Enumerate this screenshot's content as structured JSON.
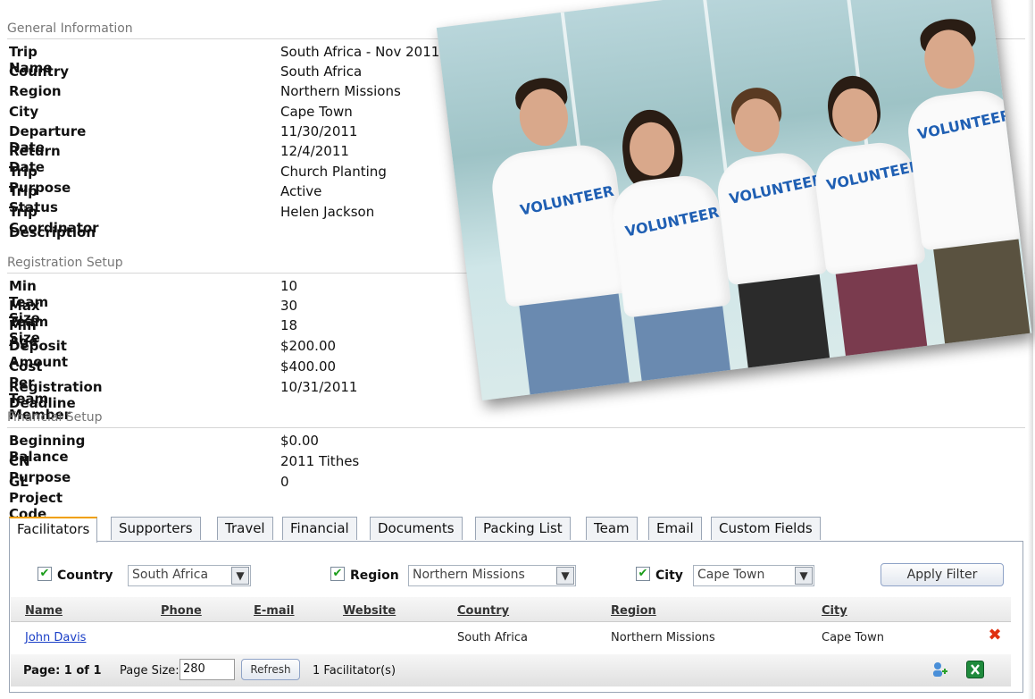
{
  "sections": {
    "general": "General Information",
    "registration": "Registration Setup",
    "financial": "Financial Setup"
  },
  "general_fields": [
    {
      "label": "Trip Name",
      "value": "South Africa - Nov 2011"
    },
    {
      "label": "Country",
      "value": "South Africa"
    },
    {
      "label": "Region",
      "value": "Northern Missions"
    },
    {
      "label": "City",
      "value": "Cape Town"
    },
    {
      "label": "Departure Date",
      "value": "11/30/2011"
    },
    {
      "label": "Return Date",
      "value": "12/4/2011"
    },
    {
      "label": "Trip Purpose",
      "value": "Church Planting"
    },
    {
      "label": "Trip Status",
      "value": "Active"
    },
    {
      "label": "Trip Coordinator",
      "value": "Helen Jackson"
    },
    {
      "label": "Description",
      "value": ""
    }
  ],
  "registration_fields": [
    {
      "label": "Min Team Size",
      "value": "10"
    },
    {
      "label": "Max Team Size",
      "value": "30"
    },
    {
      "label": "Min Age",
      "value": "18"
    },
    {
      "label": "Deposit Amount",
      "value": "$200.00"
    },
    {
      "label": "Cost Per Team Member",
      "value": "$400.00"
    },
    {
      "label": "Registration Deadline",
      "value": "10/31/2011"
    }
  ],
  "financial_fields": [
    {
      "label": "Beginning Balance",
      "value": "$0.00"
    },
    {
      "label": "CN Purpose",
      "value": "2011 Tithes"
    },
    {
      "label": "GL Project Code",
      "value": "0"
    }
  ],
  "photo": {
    "shirt_text": "VOLUNTEER"
  },
  "tabs": [
    "Facilitators",
    "Supporters",
    "Travel",
    "Financial",
    "Documents",
    "Packing List",
    "Team",
    "Email",
    "Custom Fields"
  ],
  "filters": {
    "country_label": "Country",
    "country_value": "South Africa",
    "region_label": "Region",
    "region_value": "Northern Missions",
    "city_label": "City",
    "city_value": "Cape Town",
    "apply_label": "Apply Filter",
    "checkmark": "✔",
    "arrow": "▼"
  },
  "grid": {
    "columns": [
      "Name",
      "Phone",
      "E-mail",
      "Website",
      "Country",
      "Region",
      "City"
    ],
    "rows": [
      {
        "name": "John Davis",
        "phone": "",
        "email": "",
        "website": "",
        "country": "South Africa",
        "region": "Northern Missions",
        "city": "Cape Town"
      }
    ],
    "delete_glyph": "✖"
  },
  "pager": {
    "page_text": "Page: 1 of 1",
    "page_size_label": "Page Size:",
    "page_size_value": "280",
    "refresh_label": "Refresh",
    "count_text": "1 Facilitator(s)"
  },
  "icons": {
    "add_user": "add-user-icon",
    "excel": "excel-icon"
  }
}
